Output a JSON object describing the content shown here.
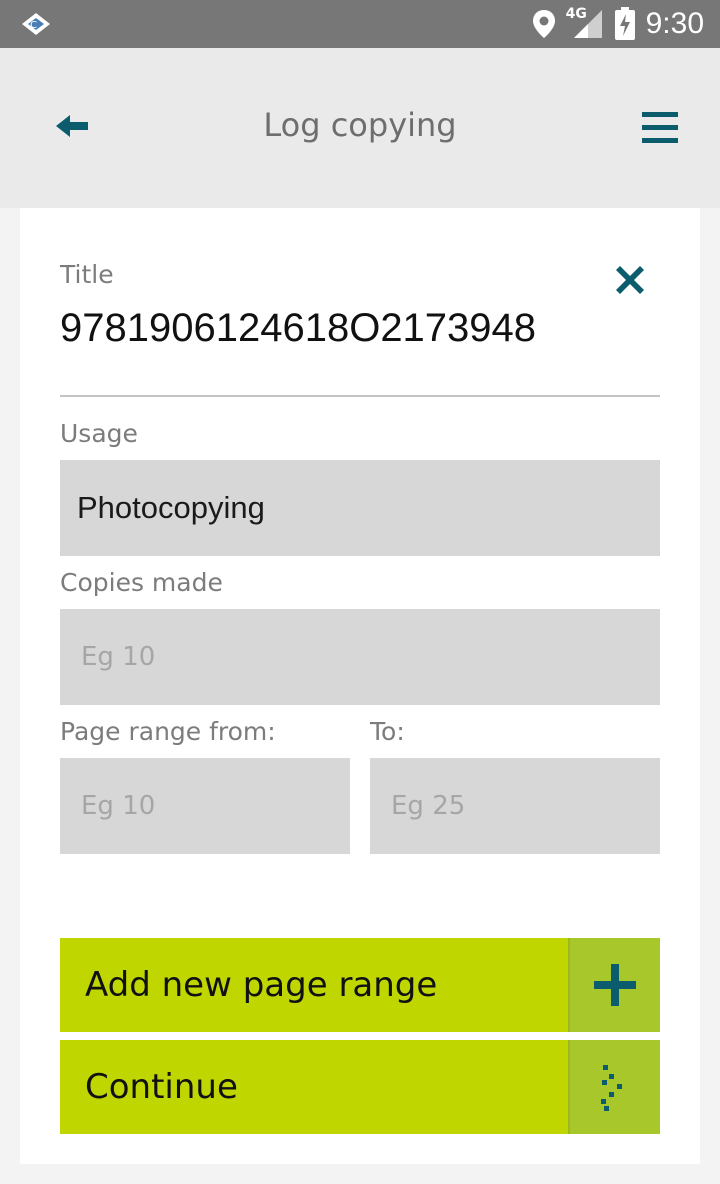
{
  "status_bar": {
    "network": "4G",
    "time": "9:30"
  },
  "header": {
    "title": "Log copying"
  },
  "form": {
    "title_label": "Title",
    "title_value": "9781906124618O2173948",
    "usage_label": "Usage",
    "usage_value": "Photocopying",
    "copies_label": "Copies made",
    "copies_placeholder": "Eg 10",
    "page_from_label": "Page range from:",
    "page_from_placeholder": "Eg 10",
    "page_to_label": "To:",
    "page_to_placeholder": "Eg 25"
  },
  "actions": {
    "add_range_label": "Add new page range",
    "continue_label": "Continue"
  },
  "colors": {
    "accent_teal": "#0b5d6e",
    "button_green": "#bfd600",
    "button_icon_green": "#a8c72a"
  },
  "icons": {
    "back": "arrow-left-icon",
    "menu": "hamburger-menu-icon",
    "clear": "close-icon",
    "add": "plus-icon",
    "continue": "dots-arrow-icon"
  }
}
